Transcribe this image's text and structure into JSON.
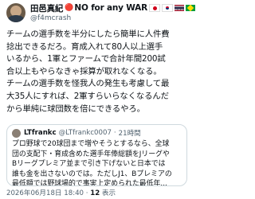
{
  "author": {
    "name": "田邑真紀",
    "tagline": "NO for any WAR",
    "handle": "@f4mcrash"
  },
  "tweet_lines": [
    "チームの選手数を半分にしたら簡単に人件費",
    "捻出できるだろ。育成入れて80人以上選手",
    "いるから、1軍とファームで合計年間200試",
    "合以上もやらなきゃ採算が取れなくなる。",
    "チームの選手数を怪我人の発生も考慮して最",
    "大35人にすれば、2軍すらいらなくなるんだ",
    "から単純に球団数を倍にできるやろ。"
  ],
  "quoted": {
    "name": "LTfrankc",
    "handle": "@LTfrankc0007",
    "time": "21時間",
    "lines": [
      "プロ野球で20球団まで増やそうとするなら、全球",
      "団の支配下・育成含めた選手年俸総額をJリーグや",
      "Bリーグプレミア並まで引き下げないと日本では",
      "誰も金を出さないのでは。ただしJ1、Bプレミアの",
      "最低額では野球場的で事実上定められた最低年..."
    ]
  },
  "footer": {
    "timestamp": "2026年06月18日 18:40 ·",
    "views": "12",
    "views_label": "表示"
  }
}
